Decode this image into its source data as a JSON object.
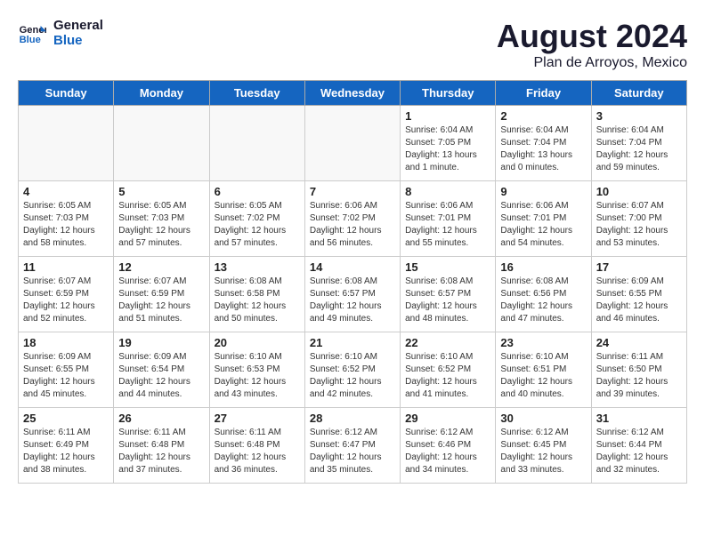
{
  "logo": {
    "line1": "General",
    "line2": "Blue"
  },
  "header": {
    "month": "August 2024",
    "location": "Plan de Arroyos, Mexico"
  },
  "days_of_week": [
    "Sunday",
    "Monday",
    "Tuesday",
    "Wednesday",
    "Thursday",
    "Friday",
    "Saturday"
  ],
  "weeks": [
    [
      {
        "day": "",
        "info": ""
      },
      {
        "day": "",
        "info": ""
      },
      {
        "day": "",
        "info": ""
      },
      {
        "day": "",
        "info": ""
      },
      {
        "day": "1",
        "info": "Sunrise: 6:04 AM\nSunset: 7:05 PM\nDaylight: 13 hours\nand 1 minute."
      },
      {
        "day": "2",
        "info": "Sunrise: 6:04 AM\nSunset: 7:04 PM\nDaylight: 13 hours\nand 0 minutes."
      },
      {
        "day": "3",
        "info": "Sunrise: 6:04 AM\nSunset: 7:04 PM\nDaylight: 12 hours\nand 59 minutes."
      }
    ],
    [
      {
        "day": "4",
        "info": "Sunrise: 6:05 AM\nSunset: 7:03 PM\nDaylight: 12 hours\nand 58 minutes."
      },
      {
        "day": "5",
        "info": "Sunrise: 6:05 AM\nSunset: 7:03 PM\nDaylight: 12 hours\nand 57 minutes."
      },
      {
        "day": "6",
        "info": "Sunrise: 6:05 AM\nSunset: 7:02 PM\nDaylight: 12 hours\nand 57 minutes."
      },
      {
        "day": "7",
        "info": "Sunrise: 6:06 AM\nSunset: 7:02 PM\nDaylight: 12 hours\nand 56 minutes."
      },
      {
        "day": "8",
        "info": "Sunrise: 6:06 AM\nSunset: 7:01 PM\nDaylight: 12 hours\nand 55 minutes."
      },
      {
        "day": "9",
        "info": "Sunrise: 6:06 AM\nSunset: 7:01 PM\nDaylight: 12 hours\nand 54 minutes."
      },
      {
        "day": "10",
        "info": "Sunrise: 6:07 AM\nSunset: 7:00 PM\nDaylight: 12 hours\nand 53 minutes."
      }
    ],
    [
      {
        "day": "11",
        "info": "Sunrise: 6:07 AM\nSunset: 6:59 PM\nDaylight: 12 hours\nand 52 minutes."
      },
      {
        "day": "12",
        "info": "Sunrise: 6:07 AM\nSunset: 6:59 PM\nDaylight: 12 hours\nand 51 minutes."
      },
      {
        "day": "13",
        "info": "Sunrise: 6:08 AM\nSunset: 6:58 PM\nDaylight: 12 hours\nand 50 minutes."
      },
      {
        "day": "14",
        "info": "Sunrise: 6:08 AM\nSunset: 6:57 PM\nDaylight: 12 hours\nand 49 minutes."
      },
      {
        "day": "15",
        "info": "Sunrise: 6:08 AM\nSunset: 6:57 PM\nDaylight: 12 hours\nand 48 minutes."
      },
      {
        "day": "16",
        "info": "Sunrise: 6:08 AM\nSunset: 6:56 PM\nDaylight: 12 hours\nand 47 minutes."
      },
      {
        "day": "17",
        "info": "Sunrise: 6:09 AM\nSunset: 6:55 PM\nDaylight: 12 hours\nand 46 minutes."
      }
    ],
    [
      {
        "day": "18",
        "info": "Sunrise: 6:09 AM\nSunset: 6:55 PM\nDaylight: 12 hours\nand 45 minutes."
      },
      {
        "day": "19",
        "info": "Sunrise: 6:09 AM\nSunset: 6:54 PM\nDaylight: 12 hours\nand 44 minutes."
      },
      {
        "day": "20",
        "info": "Sunrise: 6:10 AM\nSunset: 6:53 PM\nDaylight: 12 hours\nand 43 minutes."
      },
      {
        "day": "21",
        "info": "Sunrise: 6:10 AM\nSunset: 6:52 PM\nDaylight: 12 hours\nand 42 minutes."
      },
      {
        "day": "22",
        "info": "Sunrise: 6:10 AM\nSunset: 6:52 PM\nDaylight: 12 hours\nand 41 minutes."
      },
      {
        "day": "23",
        "info": "Sunrise: 6:10 AM\nSunset: 6:51 PM\nDaylight: 12 hours\nand 40 minutes."
      },
      {
        "day": "24",
        "info": "Sunrise: 6:11 AM\nSunset: 6:50 PM\nDaylight: 12 hours\nand 39 minutes."
      }
    ],
    [
      {
        "day": "25",
        "info": "Sunrise: 6:11 AM\nSunset: 6:49 PM\nDaylight: 12 hours\nand 38 minutes."
      },
      {
        "day": "26",
        "info": "Sunrise: 6:11 AM\nSunset: 6:48 PM\nDaylight: 12 hours\nand 37 minutes."
      },
      {
        "day": "27",
        "info": "Sunrise: 6:11 AM\nSunset: 6:48 PM\nDaylight: 12 hours\nand 36 minutes."
      },
      {
        "day": "28",
        "info": "Sunrise: 6:12 AM\nSunset: 6:47 PM\nDaylight: 12 hours\nand 35 minutes."
      },
      {
        "day": "29",
        "info": "Sunrise: 6:12 AM\nSunset: 6:46 PM\nDaylight: 12 hours\nand 34 minutes."
      },
      {
        "day": "30",
        "info": "Sunrise: 6:12 AM\nSunset: 6:45 PM\nDaylight: 12 hours\nand 33 minutes."
      },
      {
        "day": "31",
        "info": "Sunrise: 6:12 AM\nSunset: 6:44 PM\nDaylight: 12 hours\nand 32 minutes."
      }
    ]
  ]
}
